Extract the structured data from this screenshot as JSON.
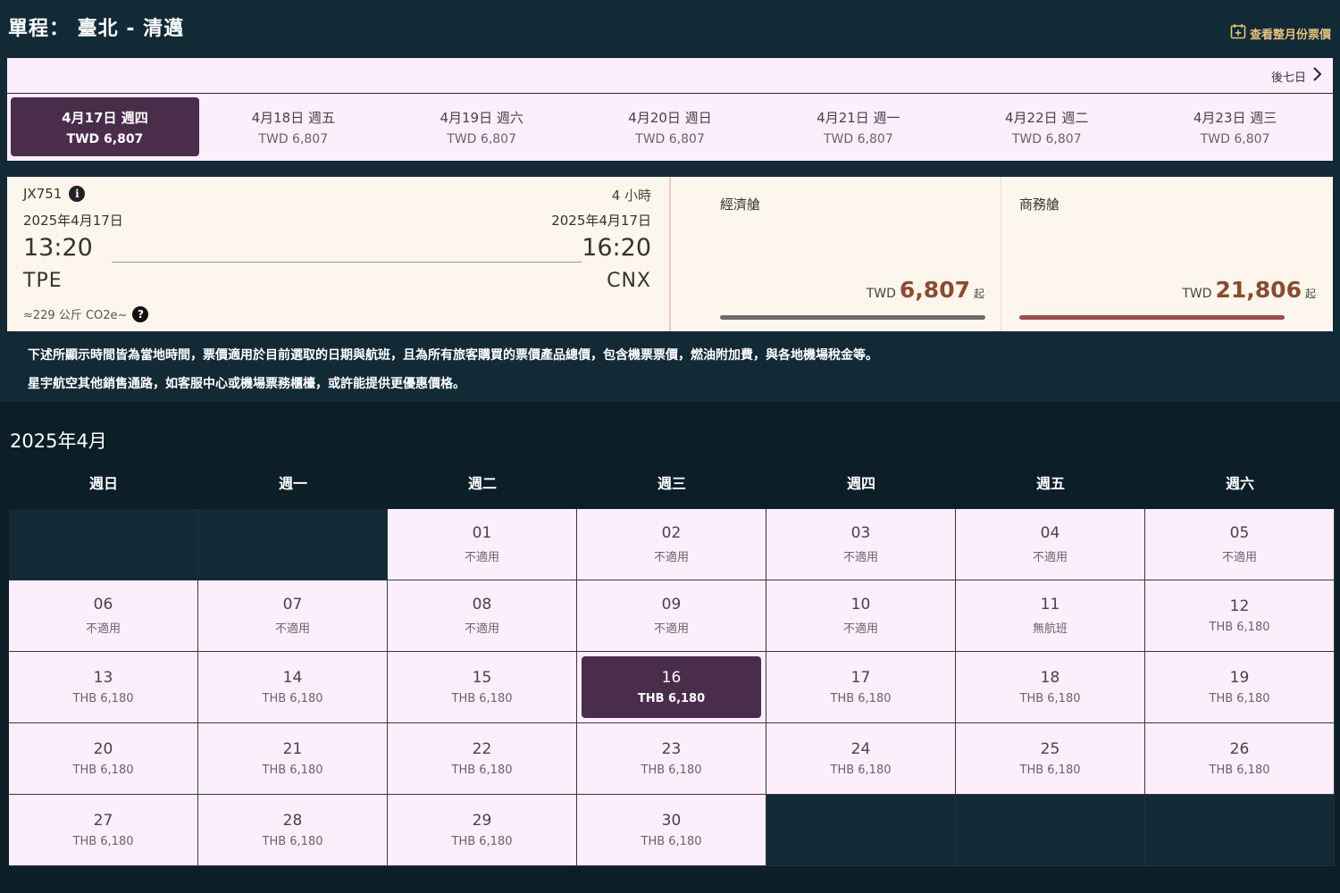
{
  "header": {
    "route_title": "單程： 臺北 - 清邁",
    "month_link": "查看整月份票價",
    "next_week": "後七日"
  },
  "dates": [
    {
      "label": "4月17日 週四",
      "price": "TWD 6,807",
      "selected": true
    },
    {
      "label": "4月18日 週五",
      "price": "TWD 6,807"
    },
    {
      "label": "4月19日 週六",
      "price": "TWD 6,807"
    },
    {
      "label": "4月20日 週日",
      "price": "TWD 6,807"
    },
    {
      "label": "4月21日 週一",
      "price": "TWD 6,807"
    },
    {
      "label": "4月22日 週二",
      "price": "TWD 6,807"
    },
    {
      "label": "4月23日 週三",
      "price": "TWD 6,807"
    }
  ],
  "flight": {
    "number": "JX751",
    "duration": "4 小時",
    "dep_date": "2025年4月17日",
    "arr_date": "2025年4月17日",
    "dep_time": "13:20",
    "arr_time": "16:20",
    "dep_code": "TPE",
    "arr_code": "CNX",
    "co2": "≈229 公斤 CO2e~"
  },
  "cabins": {
    "economy": {
      "name": "經濟艙",
      "currency": "TWD",
      "amount": "6,807",
      "from": "起"
    },
    "business": {
      "name": "商務艙",
      "currency": "TWD",
      "amount": "21,806",
      "from": "起"
    }
  },
  "notes": [
    "下述所顯示時間皆為當地時間，票價適用於目前選取的日期與航班，且為所有旅客購買的票價產品總價，包含機票票價，燃油附加費，與各地機場稅金等。",
    "星宇航空其他銷售通路，如客服中心或機場票務櫃檯，或許能提供更優惠價格。"
  ],
  "calendar": {
    "title": "2025年4月",
    "weekdays": [
      "週日",
      "週一",
      "週二",
      "週三",
      "週四",
      "週五",
      "週六"
    ],
    "cells": [
      {
        "empty": true
      },
      {
        "empty": true
      },
      {
        "day": "01",
        "info": "不適用"
      },
      {
        "day": "02",
        "info": "不適用"
      },
      {
        "day": "03",
        "info": "不適用"
      },
      {
        "day": "04",
        "info": "不適用"
      },
      {
        "day": "05",
        "info": "不適用"
      },
      {
        "day": "06",
        "info": "不適用"
      },
      {
        "day": "07",
        "info": "不適用"
      },
      {
        "day": "08",
        "info": "不適用"
      },
      {
        "day": "09",
        "info": "不適用"
      },
      {
        "day": "10",
        "info": "不適用"
      },
      {
        "day": "11",
        "info": "無航班"
      },
      {
        "day": "12",
        "info": "THB 6,180"
      },
      {
        "day": "13",
        "info": "THB 6,180"
      },
      {
        "day": "14",
        "info": "THB 6,180"
      },
      {
        "day": "15",
        "info": "THB 6,180"
      },
      {
        "day": "16",
        "info": "THB 6,180",
        "selected": true
      },
      {
        "day": "17",
        "info": "THB 6,180"
      },
      {
        "day": "18",
        "info": "THB 6,180"
      },
      {
        "day": "19",
        "info": "THB 6,180"
      },
      {
        "day": "20",
        "info": "THB 6,180"
      },
      {
        "day": "21",
        "info": "THB 6,180"
      },
      {
        "day": "22",
        "info": "THB 6,180"
      },
      {
        "day": "23",
        "info": "THB 6,180"
      },
      {
        "day": "24",
        "info": "THB 6,180"
      },
      {
        "day": "25",
        "info": "THB 6,180"
      },
      {
        "day": "26",
        "info": "THB 6,180"
      },
      {
        "day": "27",
        "info": "THB 6,180"
      },
      {
        "day": "28",
        "info": "THB 6,180"
      },
      {
        "day": "29",
        "info": "THB 6,180"
      },
      {
        "day": "30",
        "info": "THB 6,180"
      },
      {
        "empty": true
      },
      {
        "empty": true
      },
      {
        "empty": true
      }
    ]
  },
  "colors": {
    "page_bg": "#0c1e28",
    "panel_bg": "#112a36",
    "light_bg": "#fdeefd",
    "selected": "#4a2d4a",
    "price_accent": "#8c4a2f",
    "link_accent": "#e8c27a"
  },
  "icons": [
    "calendar-plus-icon",
    "chevron-right-icon",
    "info-icon",
    "help-icon"
  ]
}
